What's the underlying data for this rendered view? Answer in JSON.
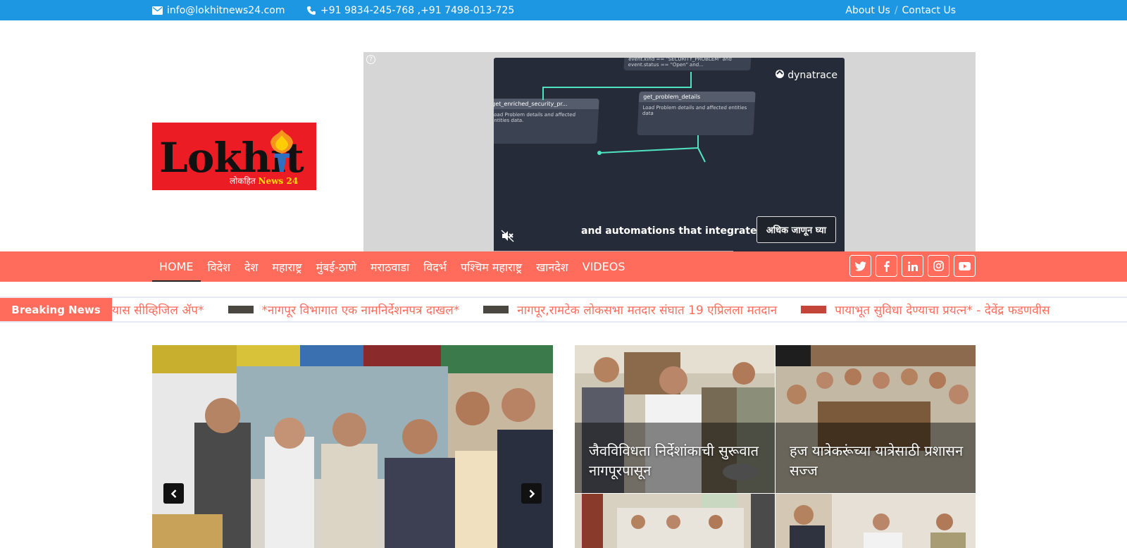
{
  "topbar": {
    "email": "info@lokhitnews24.com",
    "phone": "+91 9834-245-768 ,+91 7498-013-725",
    "about": "About Us",
    "separator": "/",
    "contact": "Contact Us"
  },
  "logo": {
    "word": "Lokhit",
    "sub_marathi": "लोकहित",
    "sub_english": "News 24"
  },
  "ad": {
    "brand": "dynatrace",
    "caption": "and automations that integrate",
    "cta": "अधिक जाणून घ्या",
    "node_a_title": "get_enriched_security_pr...",
    "node_a_text": "Load Problem details and affected entities data.",
    "node_b_title": "get_problem_details",
    "node_b_text": "Load Problem details and affected entities data",
    "node_top_text": "event.kind == \"SECURITY_PROBLEM\" and event.status == \"Open\" and..."
  },
  "nav": {
    "items": [
      "HOME",
      "विदेश",
      "देश",
      "महाराष्ट्र",
      "मुंबई-ठाणे",
      "मराठवाडा",
      "विदर्भ",
      "पश्चिम महाराष्ट्र",
      "खानदेश",
      "VIDEOS"
    ],
    "social": [
      "twitter-icon",
      "facebook-icon",
      "linkedin-icon",
      "instagram-icon",
      "youtube-icon"
    ]
  },
  "breaking": {
    "label": "Breaking News",
    "items": [
      "यास सीव्हिजिल ॲप*",
      "*नागपूर विभागात एक नामनिर्देशनपत्र दाखल*",
      "नागपूर,रामटेक लोकसभा मतदार संघात 19 एप्रिलला मतदान",
      "पायाभूत सुविधा देण्याचा प्रयत्न* - देवेंद्र फडणवीस"
    ]
  },
  "grid": {
    "cells": [
      {
        "title": "जैवविविधता निर्देशांकाची सुरूवात नागपूरपासून"
      },
      {
        "title": "हज यात्रेकरूंच्या यात्रेसाठी प्रशासन सज्ज"
      }
    ]
  },
  "colors": {
    "topbar": "#1e97e3",
    "nav": "#ff6c5c",
    "logo_bg": "#ec1c24"
  }
}
